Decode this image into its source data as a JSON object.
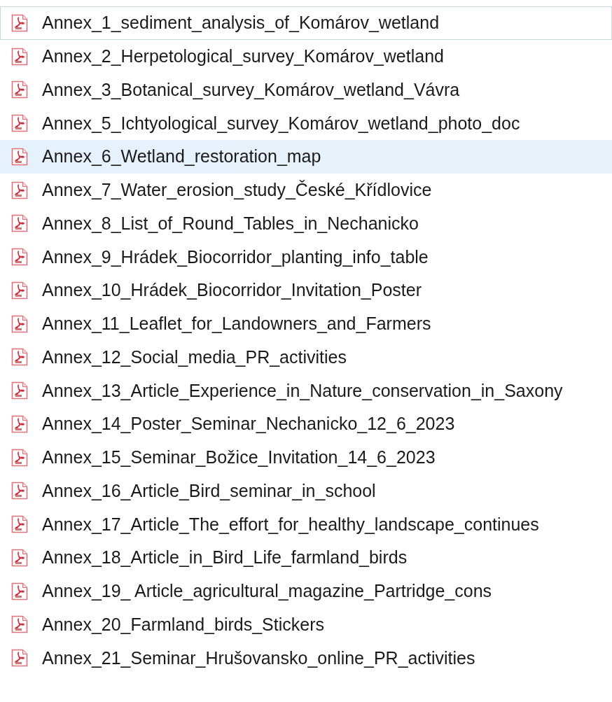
{
  "files": [
    {
      "name": "Annex_1_sediment_analysis_of_Komárov_wetland",
      "focused": true,
      "hovered": false
    },
    {
      "name": "Annex_2_Herpetological_survey_Komárov_wetland",
      "focused": false,
      "hovered": false
    },
    {
      "name": "Annex_3_Botanical_survey_Komárov_wetland_Vávra",
      "focused": false,
      "hovered": false
    },
    {
      "name": "Annex_5_Ichtyological_survey_Komárov_wetland_photo_doc",
      "focused": false,
      "hovered": false
    },
    {
      "name": "Annex_6_Wetland_restoration_map",
      "focused": false,
      "hovered": true
    },
    {
      "name": "Annex_7_Water_erosion_study_České_Křídlovice",
      "focused": false,
      "hovered": false
    },
    {
      "name": "Annex_8_List_of_Round_Tables_in_Nechanicko",
      "focused": false,
      "hovered": false
    },
    {
      "name": "Annex_9_Hrádek_Biocorridor_planting_info_table",
      "focused": false,
      "hovered": false
    },
    {
      "name": "Annex_10_Hrádek_Biocorridor_Invitation_Poster",
      "focused": false,
      "hovered": false
    },
    {
      "name": "Annex_11_Leaflet_for_Landowners_and_Farmers",
      "focused": false,
      "hovered": false
    },
    {
      "name": "Annex_12_Social_media_PR_activities",
      "focused": false,
      "hovered": false
    },
    {
      "name": "Annex_13_Article_Experience_in_Nature_conservation_in_Saxony",
      "focused": false,
      "hovered": false
    },
    {
      "name": "Annex_14_Poster_Seminar_Nechanicko_12_6_2023",
      "focused": false,
      "hovered": false
    },
    {
      "name": "Annex_15_Seminar_Božice_Invitation_14_6_2023",
      "focused": false,
      "hovered": false
    },
    {
      "name": "Annex_16_Article_Bird_seminar_in_school",
      "focused": false,
      "hovered": false
    },
    {
      "name": "Annex_17_Article_The_effort_for_healthy_landscape_continues",
      "focused": false,
      "hovered": false
    },
    {
      "name": "Annex_18_Article_in_Bird_Life_farmland_birds",
      "focused": false,
      "hovered": false
    },
    {
      "name": "Annex_19_ Article_agricultural_magazine_Partridge_cons",
      "focused": false,
      "hovered": false
    },
    {
      "name": "Annex_20_Farmland_birds_Stickers",
      "focused": false,
      "hovered": false
    },
    {
      "name": "Annex_21_Seminar_Hrušovansko_online_PR_activities",
      "focused": false,
      "hovered": false
    }
  ]
}
